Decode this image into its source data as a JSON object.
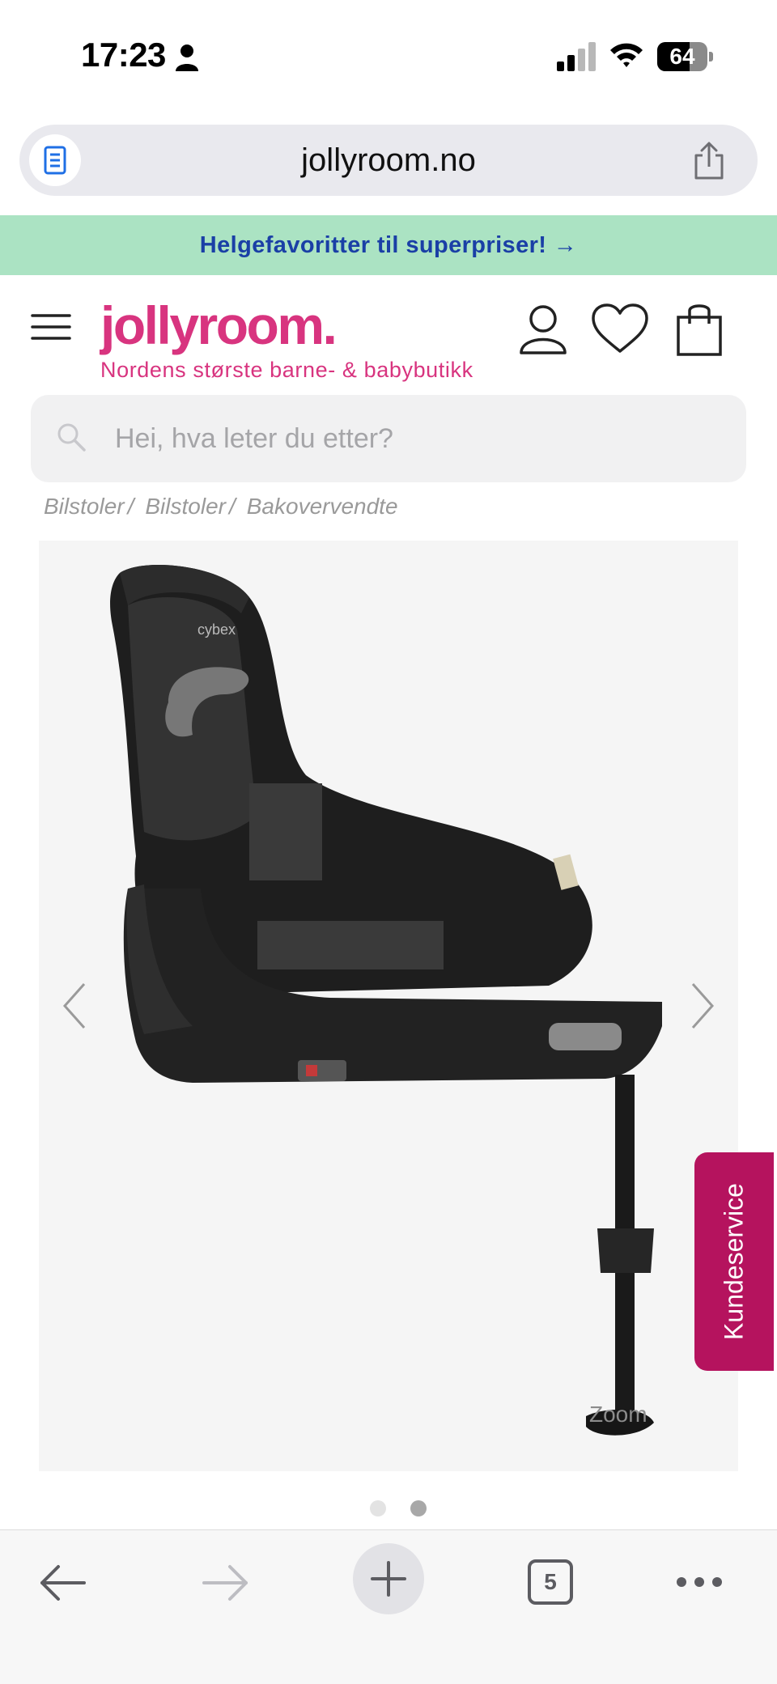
{
  "status_bar": {
    "time": "17:23",
    "battery_percent": "64",
    "battery_level": 0.64,
    "signal_bars": 2
  },
  "browser": {
    "url": "jollyroom.no",
    "open_tabs": "5"
  },
  "promo_banner": {
    "text": "Helgefavoritter til superpriser! →",
    "color": "#abe3c3"
  },
  "header": {
    "logo": "jollyroom.",
    "tagline": "Nordens største barne- & babybutikk",
    "brand_color": "#d8347f"
  },
  "search": {
    "placeholder": "Hei, hva leter du etter?",
    "value": ""
  },
  "breadcrumb": [
    {
      "label": "Bilstoler"
    },
    {
      "label": "Bilstoler"
    },
    {
      "label": "Bakovervendte"
    }
  ],
  "gallery": {
    "zoom_label": "Zoom",
    "image_brand": "cybex",
    "image_count": 2,
    "active_image": 2
  },
  "kundeservice": {
    "label": "Kundeservice",
    "color": "#b5135e"
  },
  "icons": {
    "menu": "hamburger-menu-icon",
    "account": "person-icon",
    "wishlist": "heart-icon",
    "cart": "shopping-bag-icon",
    "search": "magnifier-icon"
  }
}
